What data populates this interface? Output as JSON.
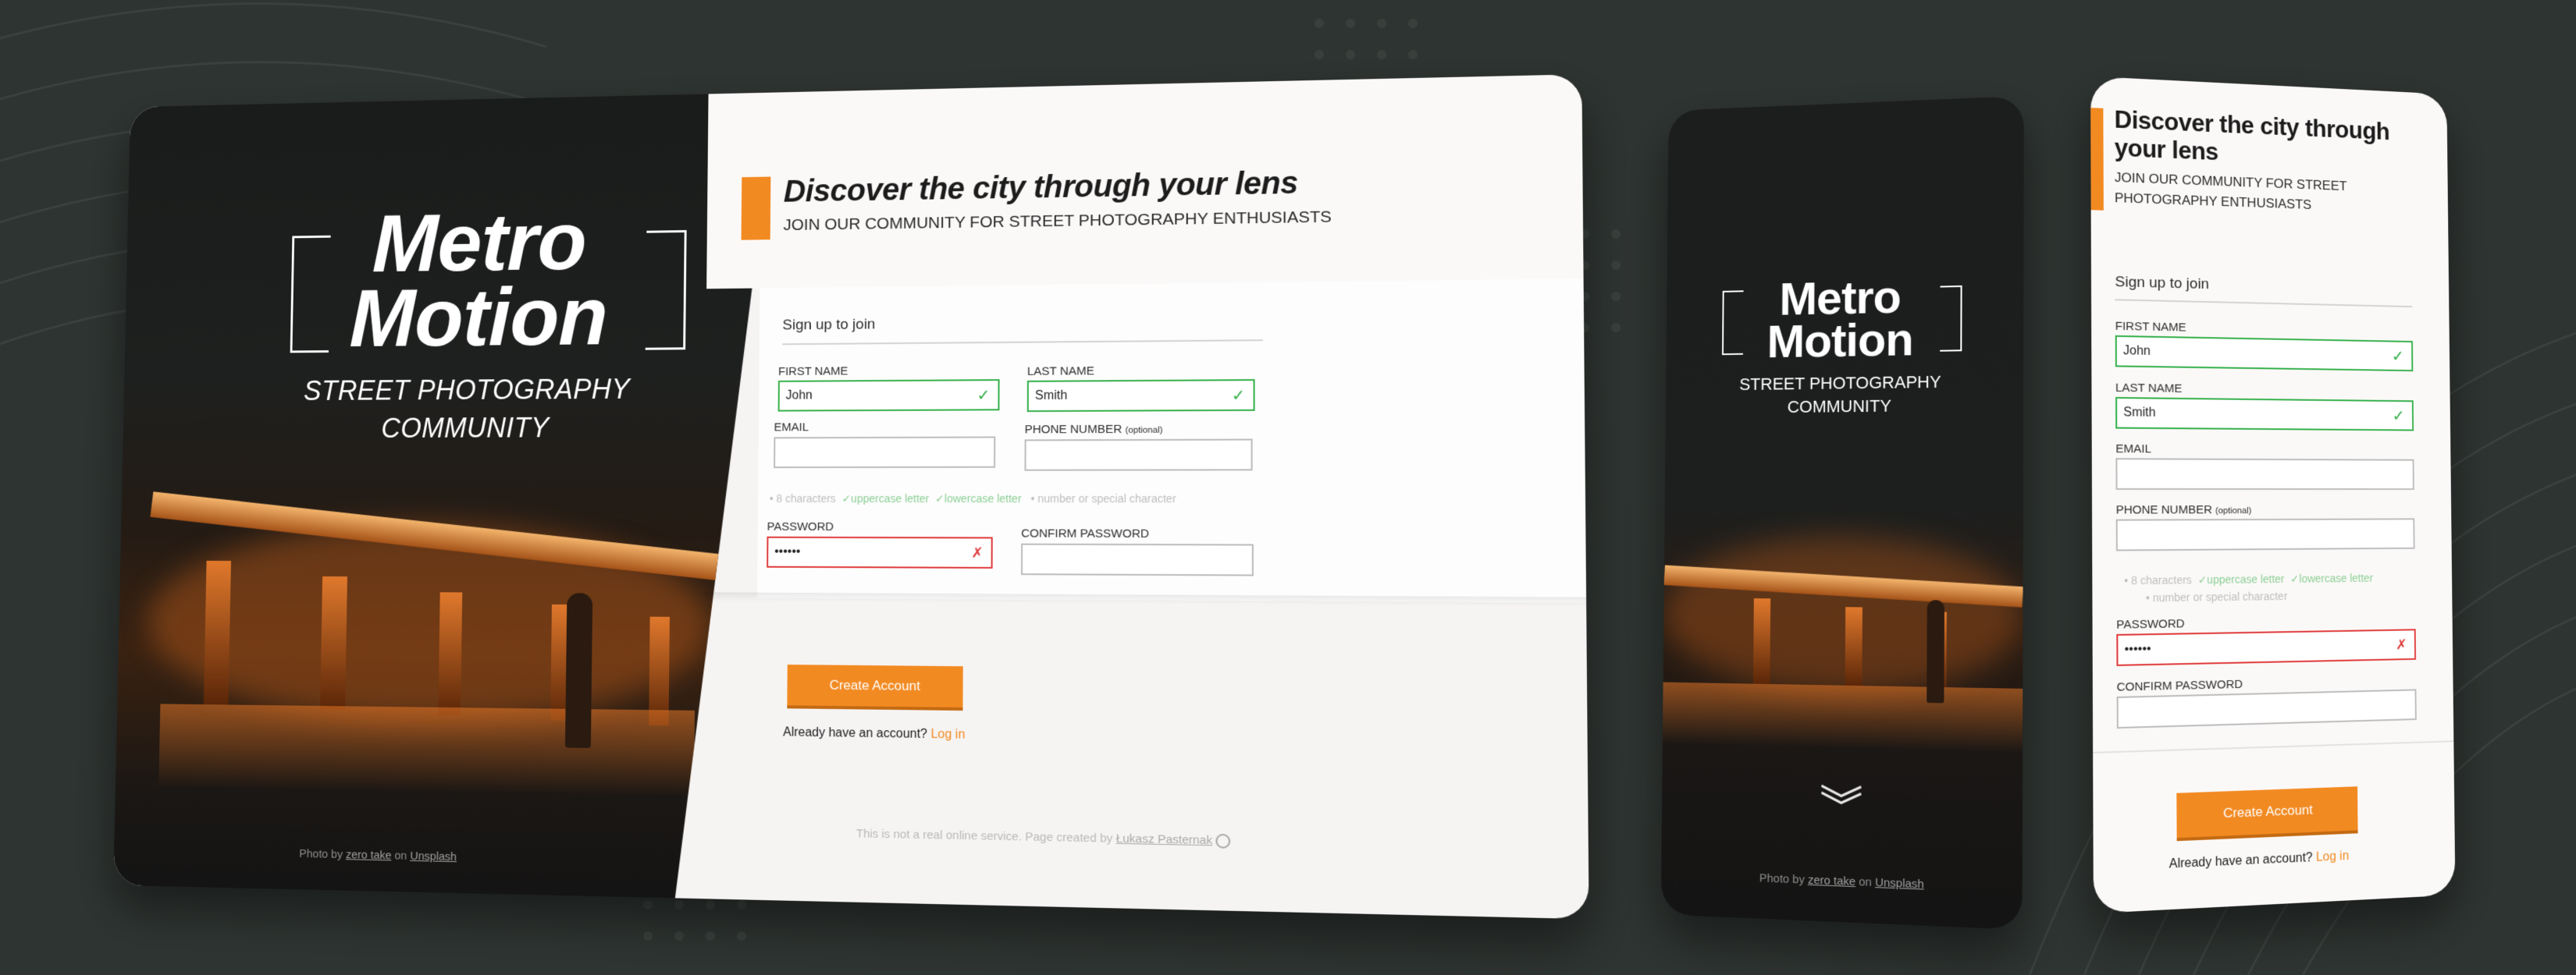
{
  "brand": {
    "line1": "Metro",
    "line2": "Motion",
    "subtitle_line1": "STREET PHOTOGRAPHY",
    "subtitle_line2": "COMMUNITY"
  },
  "credit": {
    "prefix": "Photo by",
    "author": "zero take",
    "middle": "on",
    "source": "Unsplash"
  },
  "hero": {
    "title": "Discover the city through your lens",
    "subtitle": "JOIN OUR COMMUNITY FOR STREET PHOTOGRAPHY ENTHUSIASTS"
  },
  "form": {
    "section_title": "Sign up to join",
    "first_name": {
      "label": "FIRST NAME",
      "value": "John",
      "status": "valid"
    },
    "last_name": {
      "label": "LAST NAME",
      "value": "Smith",
      "status": "valid"
    },
    "email": {
      "label": "EMAIL",
      "value": ""
    },
    "phone": {
      "label": "PHONE NUMBER",
      "label_note": "(optional)",
      "value": ""
    },
    "password_rules": [
      {
        "text": "8 characters",
        "met": false
      },
      {
        "text": "uppercase letter",
        "met": true
      },
      {
        "text": "lowercase letter",
        "met": true
      },
      {
        "text": "number or special character",
        "met": false
      }
    ],
    "password": {
      "label": "PASSWORD",
      "value": "••••••",
      "status": "invalid"
    },
    "confirm_password": {
      "label": "CONFIRM PASSWORD",
      "value": ""
    },
    "valid_mark": "✓",
    "invalid_mark": "✗",
    "rule_unmet_prefix": "•",
    "rule_met_prefix": "✓"
  },
  "cta": {
    "button": "Create Account",
    "login_prompt": "Already have an account?",
    "login_link": "Log in"
  },
  "footer": {
    "text": "This is not a real online service. Page created by",
    "author": "Łukasz Pasternak"
  },
  "mobile": {
    "scroll_hint_icon": "chevron-double-down-icon",
    "scroll_hint_glyph": "︾"
  },
  "colors": {
    "accent": "#f28a22",
    "valid": "#35b04a",
    "invalid": "#e03b3b",
    "background": "#2e3431"
  }
}
